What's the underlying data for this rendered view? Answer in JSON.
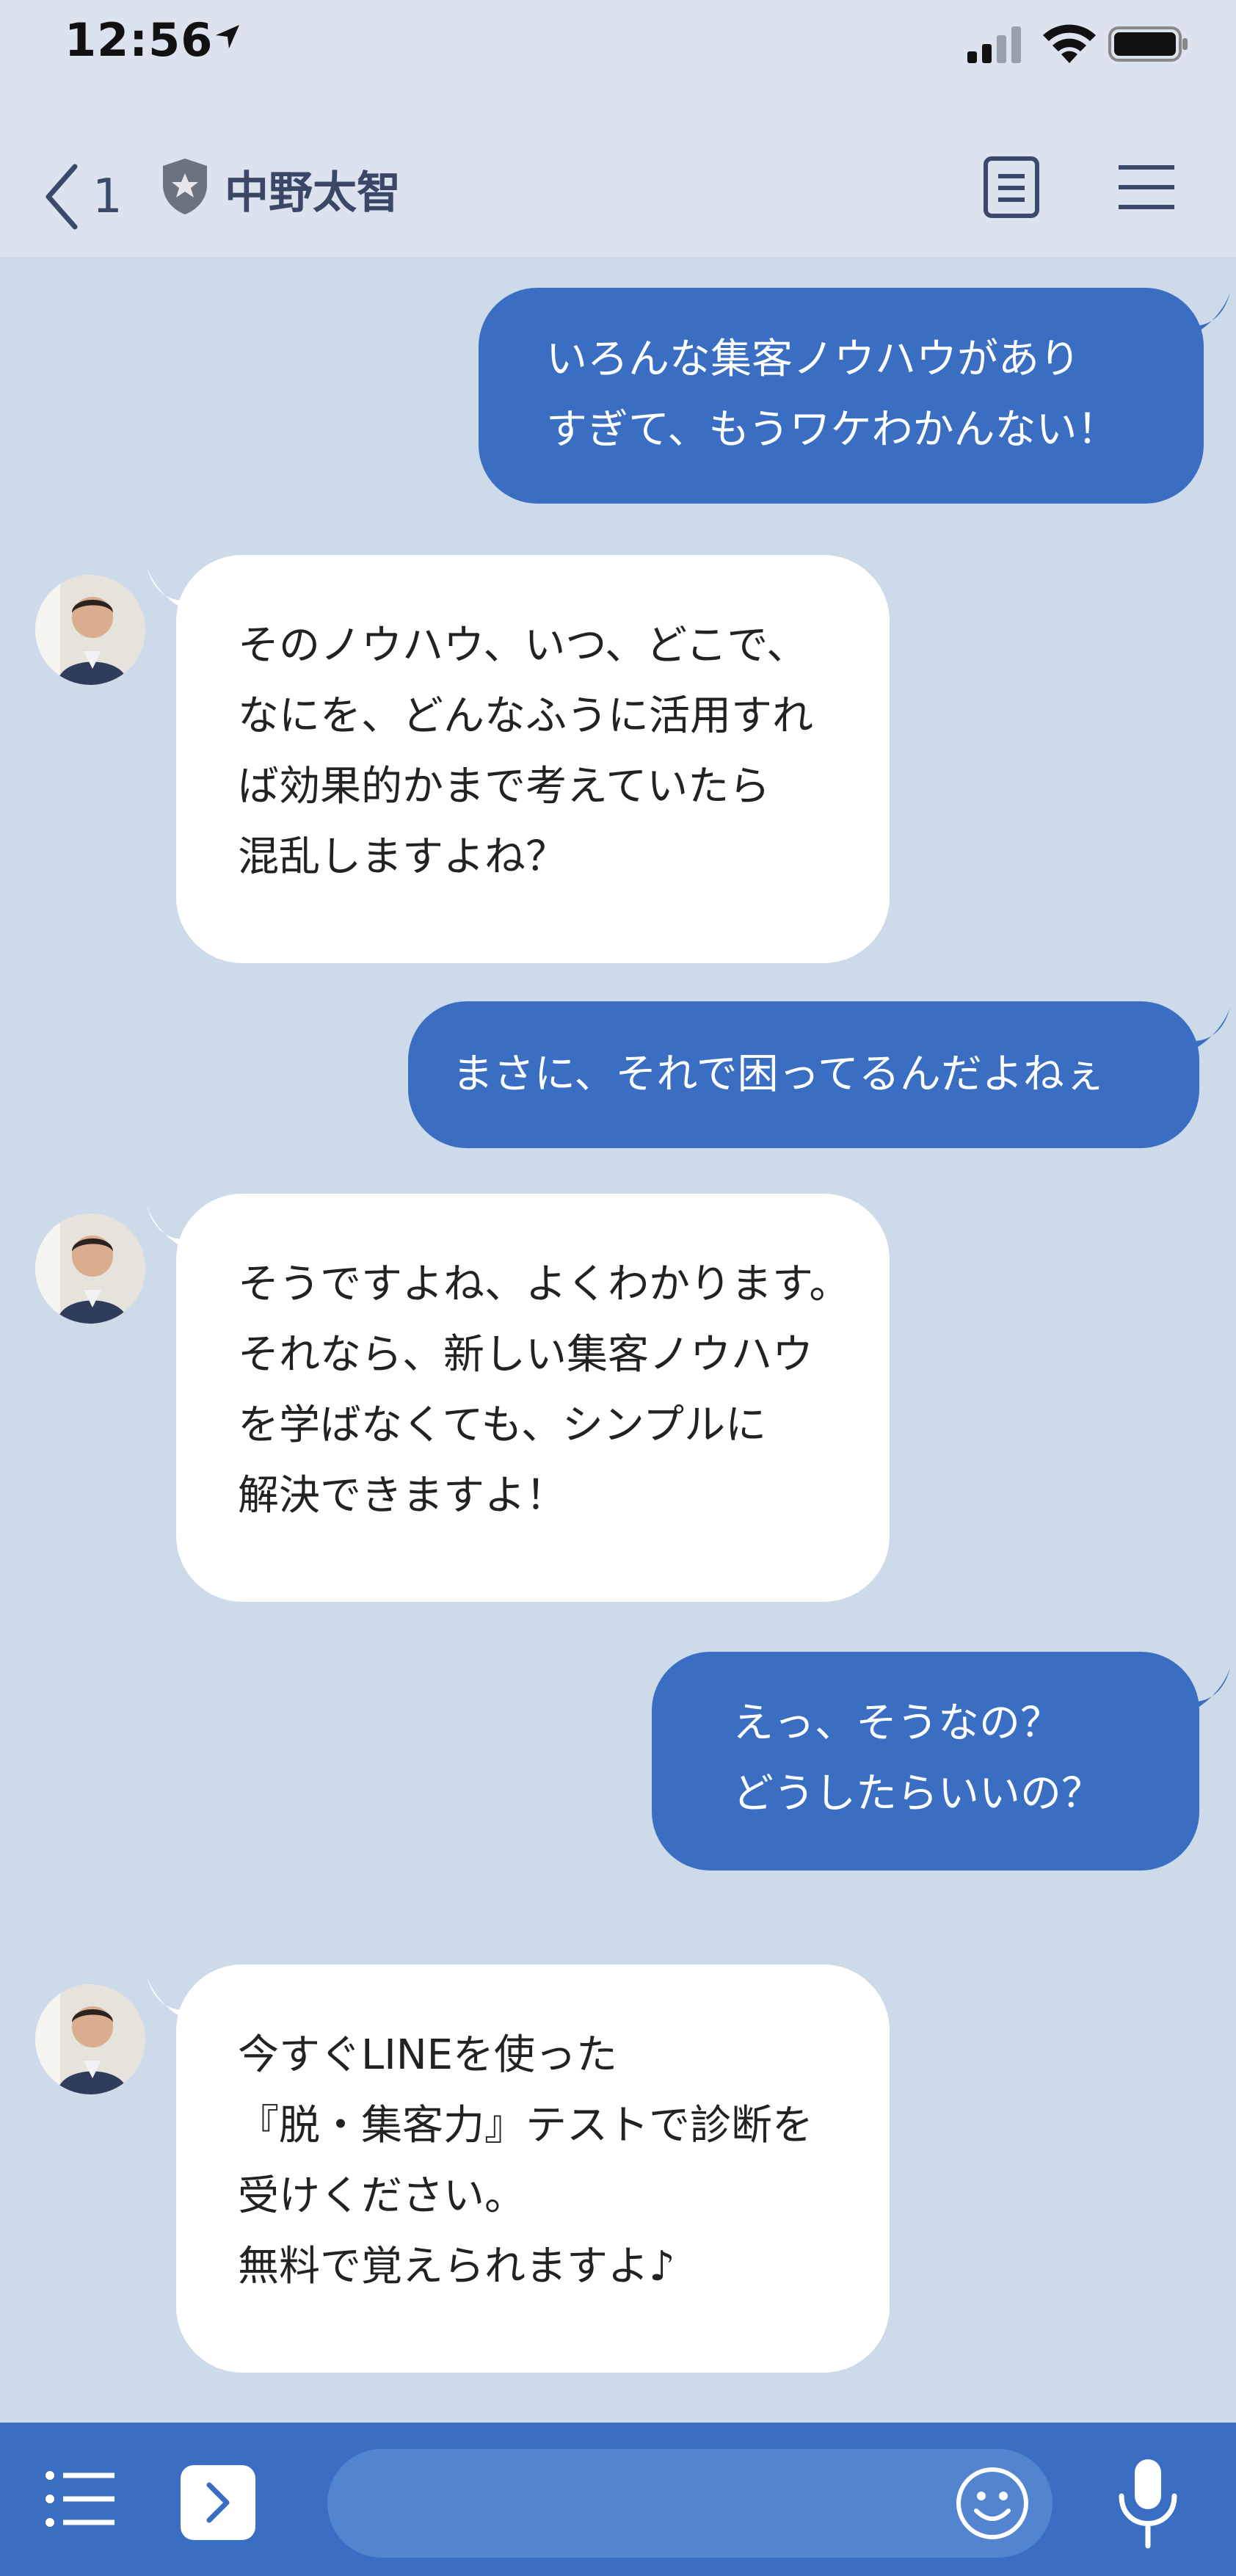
{
  "status": {
    "time": "12:56"
  },
  "header": {
    "back_count": "1",
    "contact_name": "中野太智"
  },
  "messages": [
    {
      "side": "sent",
      "text": "いろんな集客ノウハウがあり\nすぎて、もうワケわかんない！"
    },
    {
      "side": "recv",
      "text": "そのノウハウ、いつ、どこで、\nなにを、どんなふうに活用すれ\nば効果的かまで考えていたら\n混乱しますよね？"
    },
    {
      "side": "sent",
      "text": "まさに、それで困ってるんだよねぇ"
    },
    {
      "side": "recv",
      "text": "そうですよね、よくわかります。\nそれなら、新しい集客ノウハウ\nを学ばなくても、シンプルに\n解決できますよ！"
    },
    {
      "side": "sent",
      "text": "えっ、そうなの？\nどうしたらいいの？"
    },
    {
      "side": "recv",
      "text": "今すぐLINEを使った\n『脱・集客力』テストで診断を\n受けください。\n無料で覚えられますよ♪"
    }
  ],
  "input": {
    "value": "",
    "placeholder": ""
  },
  "colors": {
    "background": "#cddaea",
    "sent_bubble": "#3a6ec2",
    "received_bubble": "#ffffff",
    "bottom_bar": "#3a6ec2"
  }
}
